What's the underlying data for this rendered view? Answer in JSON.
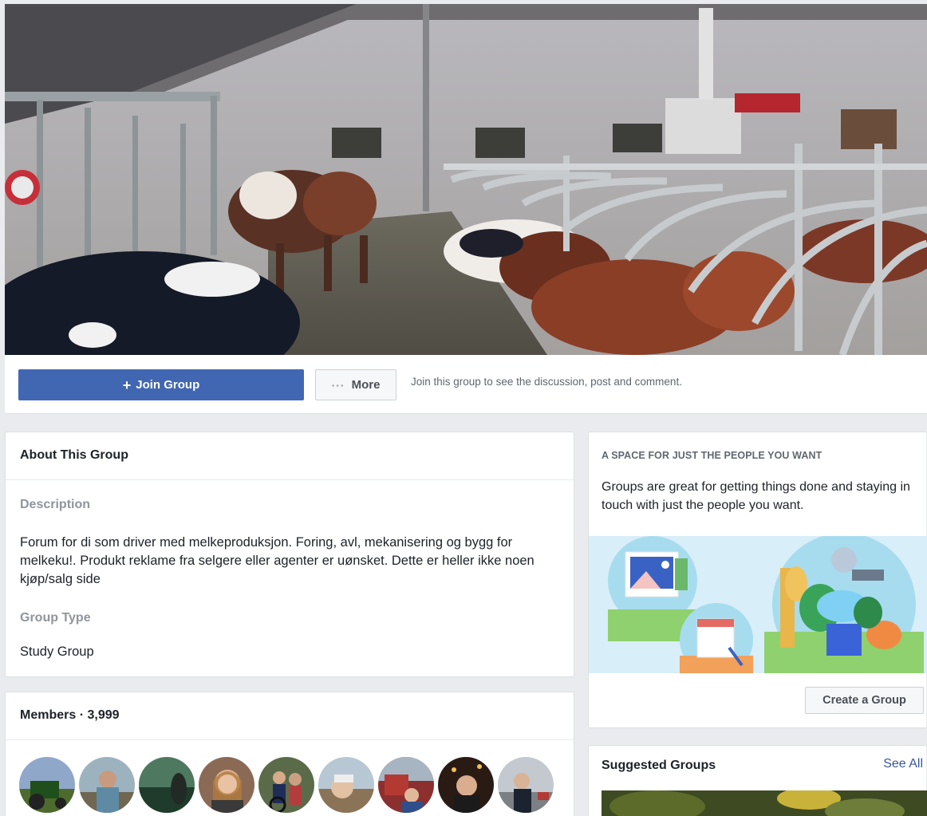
{
  "action_bar": {
    "join_label": "Join Group",
    "more_label": "More",
    "hint": "Join this group to see the discussion, post and comment."
  },
  "about": {
    "title": "About This Group",
    "description_label": "Description",
    "description": "Forum for di som driver med melkeproduksjon. Foring, avl, mekanisering og bygg for melkeku!. Produkt reklame fra selgere eller agenter er uønsket. Dette er heller ikke noen kjøp/salg side",
    "type_label": "Group Type",
    "type": "Study Group"
  },
  "members": {
    "title": "Members · 3,999"
  },
  "space": {
    "heading": "A SPACE FOR JUST THE PEOPLE YOU WANT",
    "text": "Groups are great for getting things done and staying in touch with just the people you want.",
    "create_label": "Create a Group"
  },
  "suggested": {
    "title": "Suggested Groups",
    "see_all": "See All"
  },
  "colors": {
    "brand_blue": "#4267b2",
    "link_blue": "#365899",
    "page_bg": "#e9ebee"
  },
  "icons": [
    "plus-icon",
    "more-dots-icon"
  ]
}
